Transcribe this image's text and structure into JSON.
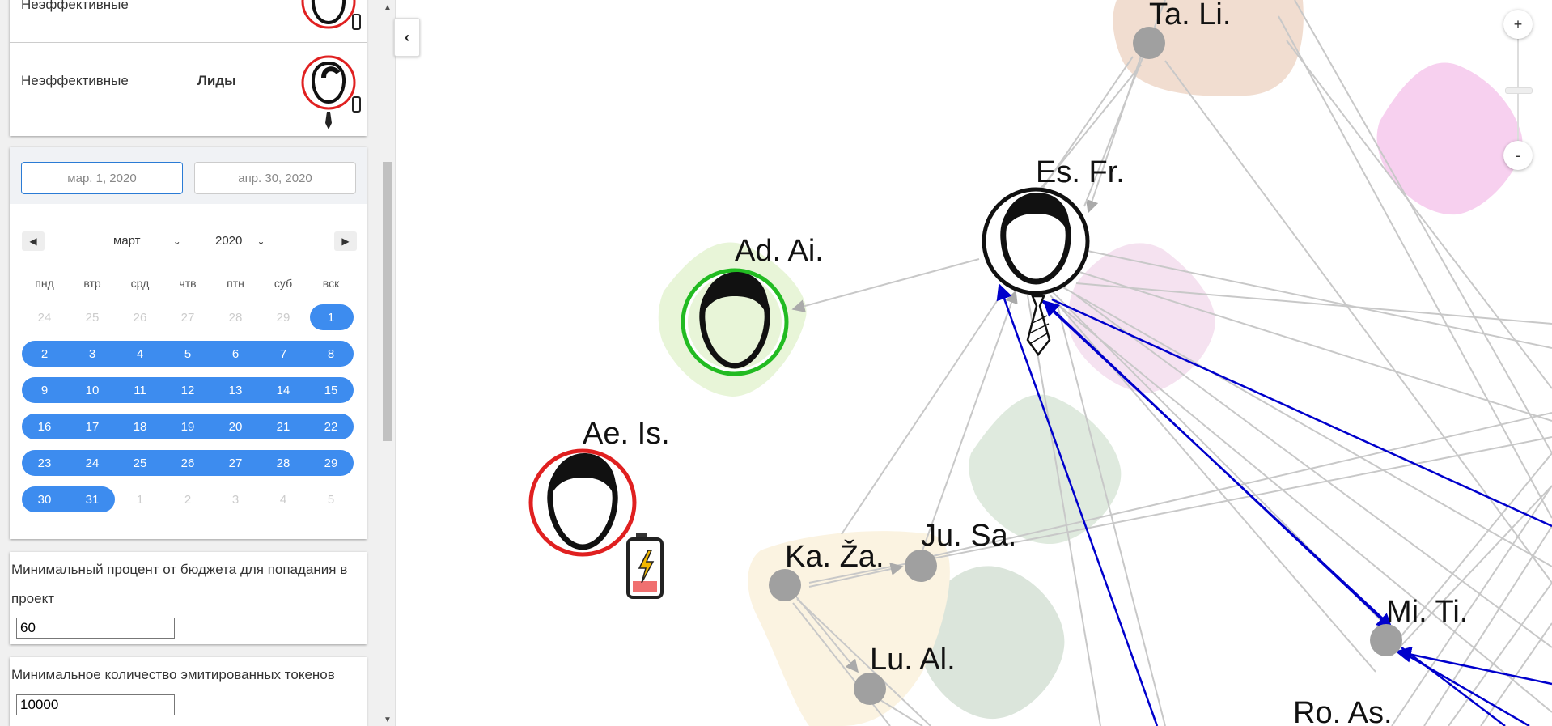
{
  "legend": {
    "row1": {
      "label": "Неэффективные"
    },
    "row2": {
      "label": "Неэффективные",
      "role": "Лиды"
    }
  },
  "date_range": {
    "start": "мар. 1, 2020",
    "end": "апр. 30, 2020"
  },
  "calendar": {
    "month": "март",
    "year": "2020",
    "weekdays": [
      "пнд",
      "втр",
      "срд",
      "чтв",
      "птн",
      "суб",
      "вск"
    ],
    "weeks": [
      [
        "24",
        "25",
        "26",
        "27",
        "28",
        "29",
        "1"
      ],
      [
        "2",
        "3",
        "4",
        "5",
        "6",
        "7",
        "8"
      ],
      [
        "9",
        "10",
        "11",
        "12",
        "13",
        "14",
        "15"
      ],
      [
        "16",
        "17",
        "18",
        "19",
        "20",
        "21",
        "22"
      ],
      [
        "23",
        "24",
        "25",
        "26",
        "27",
        "28",
        "29"
      ],
      [
        "30",
        "31",
        "1",
        "2",
        "3",
        "4",
        "5"
      ]
    ],
    "selected_start_day": "1",
    "selected_end_day": "31"
  },
  "filters": {
    "min_budget_label": "Минимальный процент от бюджета для попадания в проект",
    "min_budget_value": "60",
    "min_tokens_label": "Минимальное количество эмитированных токенов",
    "min_tokens_value": "10000"
  },
  "zoom": {
    "in": "+",
    "out": "-"
  },
  "graph": {
    "nodes": {
      "ta_li": "Ta. Li.",
      "es_fr": "Es. Fr.",
      "ad_ai": "Ad. Ai.",
      "ae_is": "Ae. Is.",
      "ka_za": "Ka. Ža.",
      "ju_sa": "Ju. Sa.",
      "lu_al": "Lu. Al.",
      "mi_ti": "Mi. Ti.",
      "ro_as": "Ro. As."
    }
  },
  "colors": {
    "accent": "#3d8cef",
    "ineffective_ring": "#e02020",
    "effective_ring": "#22bb22",
    "highlight_edge": "#0000cc",
    "edge": "#c8c8c8",
    "node": "#a0a0a0"
  },
  "icons": [
    "person-head-icon",
    "tie-icon",
    "battery-icon",
    "collapse-chevron-icon"
  ]
}
